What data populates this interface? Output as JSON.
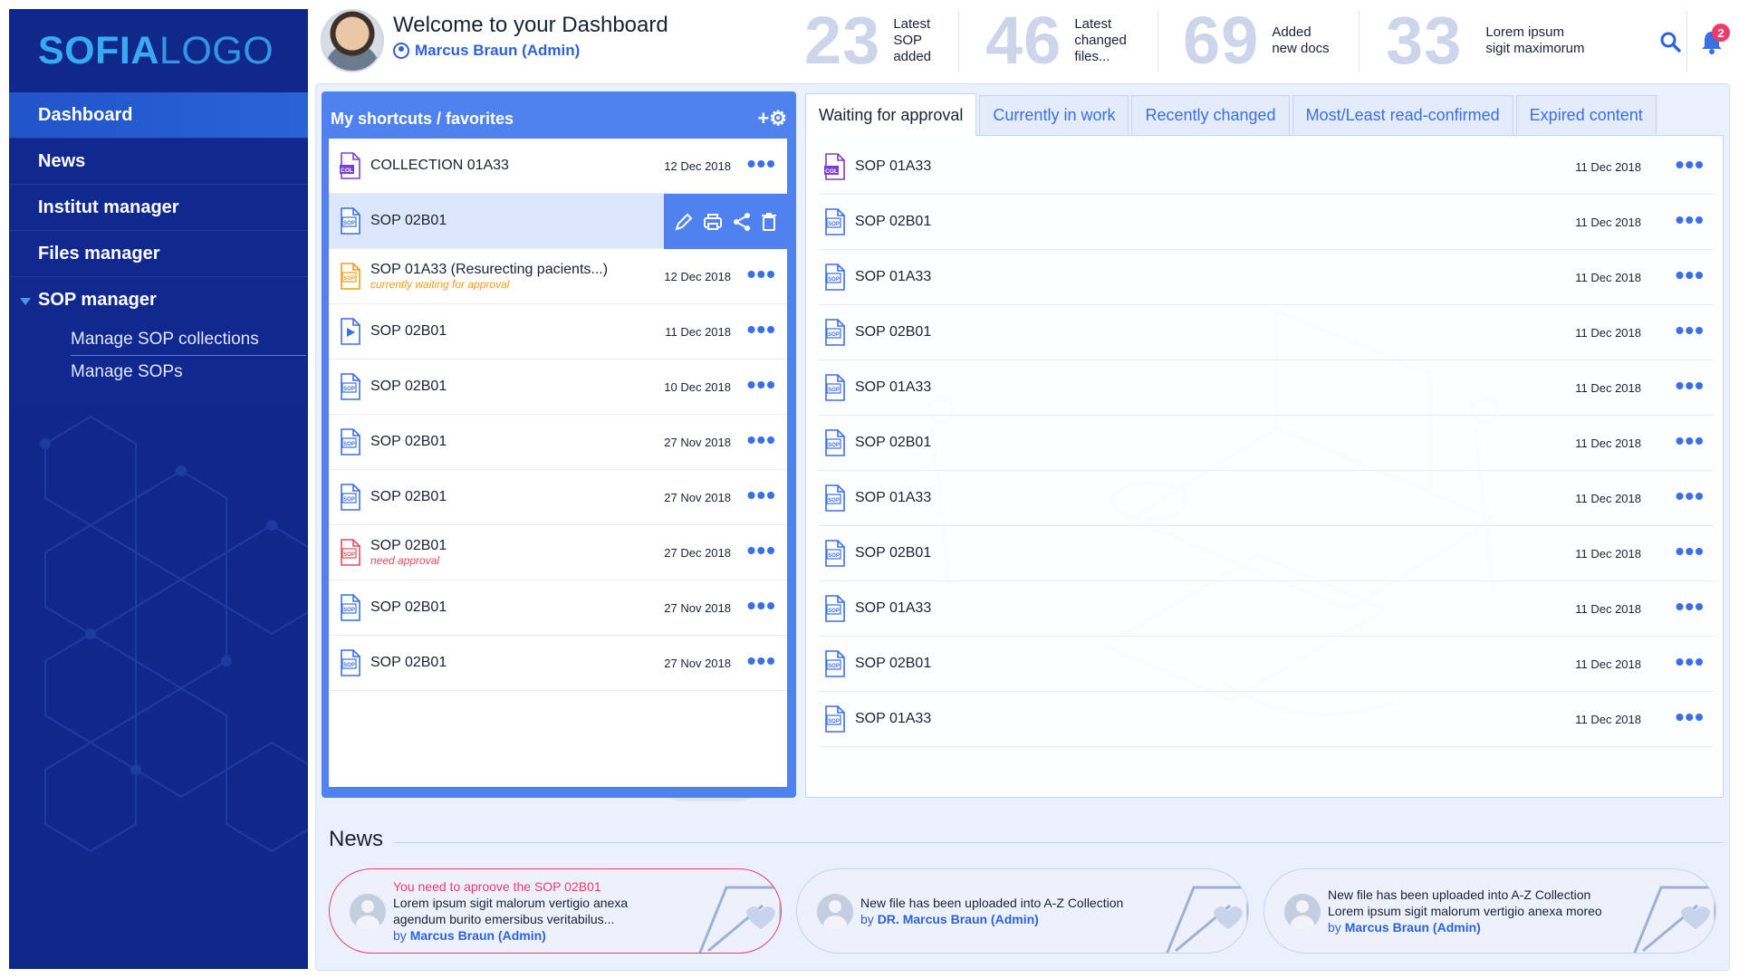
{
  "brand": {
    "logo_bold": "SOFIA",
    "logo_light": "LOGO"
  },
  "sidebar": {
    "items": [
      {
        "label": "Dashboard"
      },
      {
        "label": "News"
      },
      {
        "label": "Institut manager"
      },
      {
        "label": "Files manager"
      },
      {
        "label": "SOP manager"
      }
    ],
    "sop_subitems": [
      {
        "label": "Manage SOP collections"
      },
      {
        "label": "Manage SOPs"
      }
    ]
  },
  "header": {
    "welcome": "Welcome to your Dashboard",
    "user": "Marcus Braun (Admin)",
    "notifications_count": "2"
  },
  "stats": [
    {
      "value": "23",
      "line1": "Latest",
      "line2": "SOP",
      "line3": "added"
    },
    {
      "value": "46",
      "line1": "Latest",
      "line2": "changed",
      "line3": "files..."
    },
    {
      "value": "69",
      "line1": "Added",
      "line2": "new docs",
      "line3": ""
    },
    {
      "value": "33",
      "line1": "Lorem ipsum",
      "line2": "sigit maximorum",
      "line3": ""
    }
  ],
  "shortcuts": {
    "title": "My shortcuts / favorites",
    "add_settings_label": "+⚙",
    "more_label": "•••",
    "rows": [
      {
        "name": "COLLECTION 01A33",
        "date": "12 Dec 2018",
        "icon": "collection-icon",
        "note": ""
      },
      {
        "name": "SOP 02B01",
        "date": "",
        "icon": "sop-file-icon",
        "note": ""
      },
      {
        "name": "SOP 01A33 (Resurecting pacients...)",
        "date": "12 Dec 2018",
        "icon": "sop-file-icon-pending",
        "note": "currently waiting for approval"
      },
      {
        "name": "SOP 02B01",
        "date": "11 Dec 2018",
        "icon": "video-file-icon",
        "note": ""
      },
      {
        "name": "SOP 02B01",
        "date": "10 Dec 2018",
        "icon": "sop-file-icon",
        "note": ""
      },
      {
        "name": "SOP 02B01",
        "date": "27 Nov 2018",
        "icon": "sop-file-icon",
        "note": ""
      },
      {
        "name": "SOP 02B01",
        "date": "27 Nov 2018",
        "icon": "sop-file-icon",
        "note": ""
      },
      {
        "name": "SOP 02B01",
        "date": "27 Dec 2018",
        "icon": "sop-file-icon-alert",
        "note": "need approval"
      },
      {
        "name": "SOP 02B01",
        "date": "27 Nov 2018",
        "icon": "sop-file-icon",
        "note": ""
      },
      {
        "name": "SOP 02B01",
        "date": "27 Nov 2018",
        "icon": "sop-file-icon",
        "note": ""
      }
    ]
  },
  "tabs": {
    "items": [
      {
        "label": "Waiting for approval"
      },
      {
        "label": "Currently in work"
      },
      {
        "label": "Recently changed"
      },
      {
        "label": "Most/Least read-confirmed"
      },
      {
        "label": "Expired content"
      }
    ],
    "rows": [
      {
        "name": "SOP 01A33",
        "date": "11 Dec 2018",
        "icon": "collection-icon"
      },
      {
        "name": "SOP 02B01",
        "date": "11 Dec 2018",
        "icon": "sop-file-icon"
      },
      {
        "name": "SOP 01A33",
        "date": "11 Dec 2018",
        "icon": "sop-file-icon"
      },
      {
        "name": "SOP 02B01",
        "date": "11 Dec 2018",
        "icon": "sop-file-icon"
      },
      {
        "name": "SOP 01A33",
        "date": "11 Dec 2018",
        "icon": "sop-file-icon"
      },
      {
        "name": "SOP 02B01",
        "date": "11 Dec 2018",
        "icon": "sop-file-icon"
      },
      {
        "name": "SOP 01A33",
        "date": "11 Dec 2018",
        "icon": "sop-file-icon"
      },
      {
        "name": "SOP 02B01",
        "date": "11 Dec 2018",
        "icon": "sop-file-icon"
      },
      {
        "name": "SOP 01A33",
        "date": "11 Dec 2018",
        "icon": "sop-file-icon"
      },
      {
        "name": "SOP 02B01",
        "date": "11 Dec 2018",
        "icon": "sop-file-icon"
      },
      {
        "name": "SOP 01A33",
        "date": "11 Dec 2018",
        "icon": "sop-file-icon"
      }
    ]
  },
  "news": {
    "title": "News",
    "cards": [
      {
        "alert": "You need to aproove the SOP 02B01",
        "line1": "Lorem ipsum sigit malorum vertigio anexa",
        "line2": "agendum burito emersibus veritabilus...",
        "by": "by",
        "author": "Marcus Braun (Admin)"
      },
      {
        "alert": "",
        "line1": "New file has been uploaded into A-Z Collection",
        "line2": "",
        "by": "by",
        "author": "DR. Marcus Braun (Admin)"
      },
      {
        "alert": "",
        "line1": "New file has been uploaded into A-Z Collection",
        "line2": "Lorem ipsum sigit malorum vertigio anexa moreo",
        "by": "by",
        "author": "Marcus Braun (Admin)"
      }
    ]
  },
  "colors": {
    "sidebar": "#10288a",
    "accent": "#4f82ee",
    "alert": "#ef3b6a",
    "pending": "#f39c12",
    "stat_number": "#cdd5ea"
  }
}
